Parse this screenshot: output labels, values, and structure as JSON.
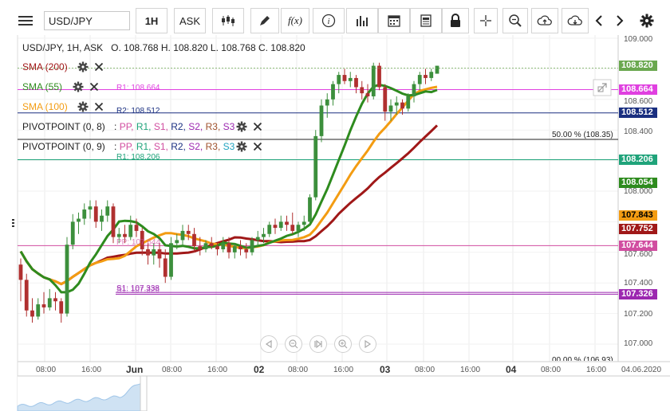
{
  "toolbar": {
    "symbol": "USD/JPY",
    "timeframe": "1H",
    "price_type": "ASK",
    "fx_label": "f(x)"
  },
  "info": {
    "line": "USD/JPY, 1H, ASK   O. 108.768 H. 108.820 L. 108.768 C. 108.820"
  },
  "indicators": {
    "sma200": "SMA (200)",
    "sma55": "SMA (55)",
    "sma100": "SMA (100)",
    "pivot1": "PIVOTPOINT (0, 8)",
    "pivot2": "PIVOTPOINT (0, 9)",
    "pivot_params": ": PP, R1, S1, R2, S2, R3, S3",
    "pivot_colon": ":",
    "pp": "PP,",
    "r1": "R1,",
    "s1": "S1,",
    "r2": "R2,",
    "s2": "S2,",
    "r3": "R3,",
    "s3": "S3"
  },
  "levels": {
    "r1_a": "R1: 108.664",
    "r2": "R2: 108.512",
    "fib50": "50.00 % (108.35)",
    "r1_b": "R1: 108.206",
    "pp": "PP: 107.644",
    "s1": "S1: 107.338",
    "s2": "S1: 107.326",
    "fib_bottom": "00.00 % (106.93)"
  },
  "price_axis": {
    "ticks": [
      "109.000",
      "108.600",
      "108.400",
      "108.000",
      "107.600",
      "107.400",
      "107.200",
      "107.000"
    ],
    "tags": [
      {
        "text": "108.820",
        "bg": "#6aa84f",
        "fg": "#ffffff"
      },
      {
        "text": "108.664",
        "bg": "#e040e0",
        "fg": "#ffffff"
      },
      {
        "text": "108.512",
        "bg": "#1a2f80",
        "fg": "#ffffff"
      },
      {
        "text": "108.206",
        "bg": "#1fa37a",
        "fg": "#ffffff"
      },
      {
        "text": "108.054",
        "bg": "#2e8b1e",
        "fg": "#ffffff"
      },
      {
        "text": "107.843",
        "bg": "#f39c12",
        "fg": "#000000"
      },
      {
        "text": "107.752",
        "bg": "#a01818",
        "fg": "#ffffff"
      },
      {
        "text": "107.644",
        "bg": "#d14da0",
        "fg": "#ffffff"
      },
      {
        "text": "107.326",
        "bg": "#9c27b0",
        "fg": "#ffffff"
      }
    ]
  },
  "time_axis": {
    "ticks": [
      "08:00",
      "16:00",
      "Jun",
      "08:00",
      "16:00",
      "02",
      "08:00",
      "16:00",
      "03",
      "08:00",
      "16:00",
      "04",
      "08:00",
      "16:00",
      "04.06.2020"
    ]
  },
  "chart_data": {
    "type": "candlestick",
    "symbol": "USD/JPY",
    "interval": "1H",
    "ylim": [
      106.95,
      109.02
    ],
    "open": 108.768,
    "high": 108.82,
    "low": 108.768,
    "close": 108.82,
    "candles": [
      [
        107.52,
        107.56,
        107.28,
        107.42
      ],
      [
        107.42,
        107.46,
        107.18,
        107.22
      ],
      [
        107.22,
        107.3,
        107.14,
        107.18
      ],
      [
        107.18,
        107.3,
        107.16,
        107.26
      ],
      [
        107.26,
        107.34,
        107.2,
        107.24
      ],
      [
        107.24,
        107.36,
        107.22,
        107.3
      ],
      [
        107.3,
        107.34,
        107.22,
        107.28
      ],
      [
        107.28,
        107.3,
        107.14,
        107.2
      ],
      [
        107.2,
        107.7,
        107.18,
        107.65
      ],
      [
        107.65,
        107.85,
        107.62,
        107.8
      ],
      [
        107.8,
        107.86,
        107.72,
        107.82
      ],
      [
        107.82,
        107.92,
        107.78,
        107.88
      ],
      [
        107.88,
        107.94,
        107.82,
        107.9
      ],
      [
        107.9,
        107.94,
        107.76,
        107.8
      ],
      [
        107.8,
        107.88,
        107.74,
        107.84
      ],
      [
        107.84,
        107.94,
        107.8,
        107.9
      ],
      [
        107.9,
        107.92,
        107.66,
        107.7
      ],
      [
        107.7,
        107.76,
        107.66,
        107.72
      ],
      [
        107.72,
        107.78,
        107.66,
        107.7
      ],
      [
        107.7,
        107.84,
        107.68,
        107.78
      ],
      [
        107.78,
        107.82,
        107.7,
        107.74
      ],
      [
        107.74,
        107.76,
        107.58,
        107.62
      ],
      [
        107.62,
        107.66,
        107.52,
        107.58
      ],
      [
        107.58,
        107.66,
        107.52,
        107.62
      ],
      [
        107.62,
        107.66,
        107.5,
        107.56
      ],
      [
        107.56,
        107.62,
        107.4,
        107.44
      ],
      [
        107.44,
        107.7,
        107.42,
        107.66
      ],
      [
        107.66,
        107.72,
        107.62,
        107.68
      ],
      [
        107.68,
        107.78,
        107.64,
        107.74
      ],
      [
        107.74,
        107.78,
        107.68,
        107.72
      ],
      [
        107.72,
        107.76,
        107.6,
        107.64
      ],
      [
        107.64,
        107.7,
        107.58,
        107.62
      ],
      [
        107.62,
        107.68,
        107.6,
        107.66
      ],
      [
        107.66,
        107.7,
        107.62,
        107.64
      ],
      [
        107.64,
        107.66,
        107.58,
        107.62
      ],
      [
        107.62,
        107.7,
        107.6,
        107.66
      ],
      [
        107.66,
        107.7,
        107.56,
        107.6
      ],
      [
        107.6,
        107.66,
        107.56,
        107.64
      ],
      [
        107.64,
        107.68,
        107.58,
        107.62
      ],
      [
        107.62,
        107.66,
        107.56,
        107.6
      ],
      [
        107.6,
        107.7,
        107.58,
        107.68
      ],
      [
        107.68,
        107.74,
        107.64,
        107.7
      ],
      [
        107.7,
        107.76,
        107.66,
        107.72
      ],
      [
        107.72,
        107.8,
        107.7,
        107.78
      ],
      [
        107.78,
        107.82,
        107.72,
        107.76
      ],
      [
        107.76,
        107.84,
        107.74,
        107.8
      ],
      [
        107.8,
        107.84,
        107.74,
        107.78
      ],
      [
        107.78,
        107.86,
        107.72,
        107.74
      ],
      [
        107.74,
        107.8,
        107.7,
        107.78
      ],
      [
        107.78,
        107.84,
        107.74,
        107.8
      ],
      [
        107.8,
        107.98,
        107.78,
        107.96
      ],
      [
        107.96,
        108.4,
        107.94,
        108.36
      ],
      [
        108.36,
        108.6,
        108.32,
        108.56
      ],
      [
        108.56,
        108.64,
        108.48,
        108.6
      ],
      [
        108.6,
        108.72,
        108.56,
        108.7
      ],
      [
        108.7,
        108.78,
        108.64,
        108.76
      ],
      [
        108.76,
        108.8,
        108.7,
        108.72
      ],
      [
        108.72,
        108.78,
        108.68,
        108.74
      ],
      [
        108.74,
        108.76,
        108.64,
        108.68
      ],
      [
        108.68,
        108.72,
        108.6,
        108.64
      ],
      [
        108.64,
        108.7,
        108.58,
        108.62
      ],
      [
        108.62,
        108.84,
        108.6,
        108.82
      ],
      [
        108.82,
        108.84,
        108.66,
        108.68
      ],
      [
        108.68,
        108.7,
        108.46,
        108.52
      ],
      [
        108.52,
        108.6,
        108.46,
        108.56
      ],
      [
        108.56,
        108.62,
        108.5,
        108.58
      ],
      [
        108.58,
        108.6,
        108.5,
        108.54
      ],
      [
        108.54,
        108.64,
        108.52,
        108.62
      ],
      [
        108.62,
        108.72,
        108.58,
        108.7
      ],
      [
        108.7,
        108.78,
        108.66,
        108.76
      ],
      [
        108.76,
        108.8,
        108.7,
        108.74
      ],
      [
        108.74,
        108.8,
        108.72,
        108.78
      ],
      [
        108.768,
        108.82,
        108.768,
        108.82
      ]
    ],
    "series": [
      {
        "name": "SMA (55)",
        "color": "#2e8b1e"
      },
      {
        "name": "SMA (100)",
        "color": "#f39c12"
      },
      {
        "name": "SMA (200)",
        "color": "#a01818"
      }
    ]
  }
}
